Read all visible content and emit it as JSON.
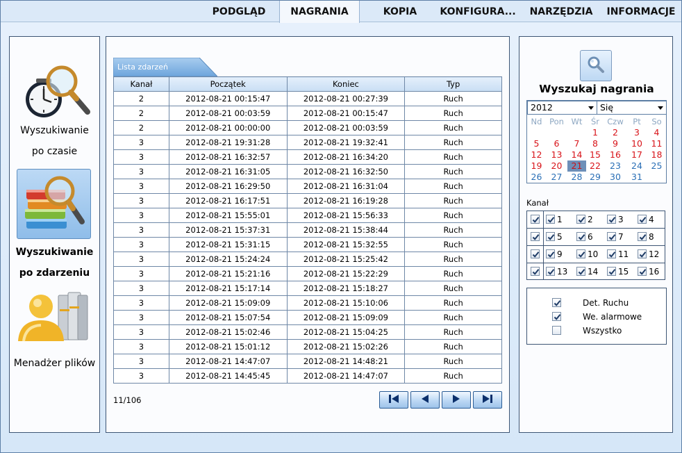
{
  "nav": {
    "tabs": [
      {
        "label": "PODGLĄD"
      },
      {
        "label": "NAGRANIA"
      },
      {
        "label": "KOPIA"
      },
      {
        "label": "KONFIGURA..."
      },
      {
        "label": "NARZĘDZIA"
      },
      {
        "label": "INFORMACJE"
      }
    ],
    "active": "NAGRANIA"
  },
  "sidebar": {
    "items": [
      {
        "line1": "Wyszukiwanie",
        "line2": "po czasie",
        "icon": "clock-magnifier-icon"
      },
      {
        "line1": "Wyszukiwanie",
        "line2": "po zdarzeniu",
        "icon": "books-magnifier-icon",
        "selected": true
      },
      {
        "line1": "Menadżer plików",
        "icon": "user-folder-icon"
      }
    ]
  },
  "event_list": {
    "tab_label": "Lista zdarzeń",
    "headers": [
      "Kanał",
      "Początek",
      "Koniec",
      "Typ"
    ],
    "rows": [
      [
        "2",
        "2012-08-21 00:15:47",
        "2012-08-21 00:27:39",
        "Ruch"
      ],
      [
        "2",
        "2012-08-21 00:03:59",
        "2012-08-21 00:15:47",
        "Ruch"
      ],
      [
        "2",
        "2012-08-21 00:00:00",
        "2012-08-21 00:03:59",
        "Ruch"
      ],
      [
        "3",
        "2012-08-21 19:31:28",
        "2012-08-21 19:32:41",
        "Ruch"
      ],
      [
        "3",
        "2012-08-21 16:32:57",
        "2012-08-21 16:34:20",
        "Ruch"
      ],
      [
        "3",
        "2012-08-21 16:31:05",
        "2012-08-21 16:32:50",
        "Ruch"
      ],
      [
        "3",
        "2012-08-21 16:29:50",
        "2012-08-21 16:31:04",
        "Ruch"
      ],
      [
        "3",
        "2012-08-21 16:17:51",
        "2012-08-21 16:19:28",
        "Ruch"
      ],
      [
        "3",
        "2012-08-21 15:55:01",
        "2012-08-21 15:56:33",
        "Ruch"
      ],
      [
        "3",
        "2012-08-21 15:37:31",
        "2012-08-21 15:38:44",
        "Ruch"
      ],
      [
        "3",
        "2012-08-21 15:31:15",
        "2012-08-21 15:32:55",
        "Ruch"
      ],
      [
        "3",
        "2012-08-21 15:24:24",
        "2012-08-21 15:25:42",
        "Ruch"
      ],
      [
        "3",
        "2012-08-21 15:21:16",
        "2012-08-21 15:22:29",
        "Ruch"
      ],
      [
        "3",
        "2012-08-21 15:17:14",
        "2012-08-21 15:18:27",
        "Ruch"
      ],
      [
        "3",
        "2012-08-21 15:09:09",
        "2012-08-21 15:10:06",
        "Ruch"
      ],
      [
        "3",
        "2012-08-21 15:07:54",
        "2012-08-21 15:09:09",
        "Ruch"
      ],
      [
        "3",
        "2012-08-21 15:02:46",
        "2012-08-21 15:04:25",
        "Ruch"
      ],
      [
        "3",
        "2012-08-21 15:01:12",
        "2012-08-21 15:02:26",
        "Ruch"
      ],
      [
        "3",
        "2012-08-21 14:47:07",
        "2012-08-21 14:48:21",
        "Ruch"
      ],
      [
        "3",
        "2012-08-21 14:45:45",
        "2012-08-21 14:47:07",
        "Ruch"
      ]
    ],
    "page_info": "11/106",
    "pager": [
      "first-page-icon",
      "prev-page-icon",
      "next-page-icon",
      "last-page-icon"
    ]
  },
  "search": {
    "title": "Wyszukaj nagrania",
    "icon": "magnifier-icon",
    "year": "2012",
    "month": "Się",
    "weekdays": [
      "Nd",
      "Pon",
      "Wt",
      "Śr",
      "Czw",
      "Pt",
      "So"
    ],
    "first_weekday_index": 3,
    "days_in_month": 31,
    "red_days": [
      1,
      2,
      3,
      4,
      5,
      6,
      7,
      8,
      9,
      10,
      11,
      12,
      13,
      14,
      15,
      16,
      17,
      18,
      19,
      20,
      21,
      22
    ],
    "selected_day": 21,
    "channel_label": "Kanał",
    "channels": [
      {
        "row_checked": true,
        "items": [
          {
            "n": "1",
            "checked": true
          },
          {
            "n": "2",
            "checked": true
          },
          {
            "n": "3",
            "checked": true
          },
          {
            "n": "4",
            "checked": true
          }
        ]
      },
      {
        "row_checked": true,
        "items": [
          {
            "n": "5",
            "checked": true
          },
          {
            "n": "6",
            "checked": true
          },
          {
            "n": "7",
            "checked": true
          },
          {
            "n": "8",
            "checked": true
          }
        ]
      },
      {
        "row_checked": true,
        "items": [
          {
            "n": "9",
            "checked": true
          },
          {
            "n": "10",
            "checked": true
          },
          {
            "n": "11",
            "checked": true
          },
          {
            "n": "12",
            "checked": true
          }
        ]
      },
      {
        "row_checked": true,
        "items": [
          {
            "n": "13",
            "checked": true
          },
          {
            "n": "14",
            "checked": true
          },
          {
            "n": "15",
            "checked": true
          },
          {
            "n": "16",
            "checked": true
          }
        ]
      }
    ],
    "types": [
      {
        "label": "Det. Ruchu",
        "checked": true
      },
      {
        "label": "We. alarmowe",
        "checked": true
      },
      {
        "label": "Wszystko",
        "checked": false
      }
    ]
  },
  "colors": {
    "accent": "#6d8fb8",
    "red_day": "#d8141a",
    "blue_day": "#2a6fb6"
  }
}
